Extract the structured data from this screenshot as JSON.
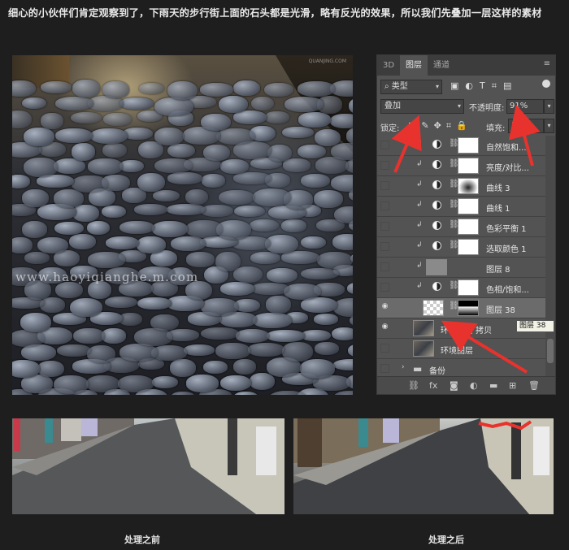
{
  "caption": "细心的小伙伴们肯定观察到了，下雨天的步行街上面的石头都是光滑，略有反光的效果，所以我们先叠加一层这样的素材",
  "photo": {
    "watermark_small": "QUANJING.COM",
    "watermark_big": "www.haoyiqianghe.m.com"
  },
  "panel": {
    "tabs": [
      {
        "label": "3D",
        "active": false
      },
      {
        "label": "图层",
        "active": true
      },
      {
        "label": "通道",
        "active": false
      }
    ],
    "filter": {
      "value": "类型",
      "icon": "search-icon"
    },
    "blend_mode": "叠加",
    "opacity_label": "不透明度:",
    "opacity_value": "91%",
    "lock_label": "锁定:",
    "fill_label": "填充:",
    "fill_value": "100",
    "layers": [
      {
        "name": "自然饱和...",
        "type": "adjustment",
        "selected": false,
        "visible": false
      },
      {
        "name": "亮度/对比...",
        "type": "adjustment",
        "selected": false,
        "visible": false
      },
      {
        "name": "曲线 3",
        "type": "adjustment-mask-dark",
        "selected": false,
        "visible": false
      },
      {
        "name": "曲线 1",
        "type": "adjustment",
        "selected": false,
        "visible": false
      },
      {
        "name": "色彩平衡 1",
        "type": "adjustment",
        "selected": false,
        "visible": false
      },
      {
        "name": "选取颜色 1",
        "type": "adjustment",
        "selected": false,
        "visible": false
      },
      {
        "name": "图层 8",
        "type": "pixel-gray",
        "selected": false,
        "visible": false
      },
      {
        "name": "色相/饱和...",
        "type": "adjustment",
        "selected": false,
        "visible": false
      },
      {
        "name": "图层 38",
        "type": "pixel-mask",
        "selected": true,
        "visible": true
      },
      {
        "name": "环境图层 拷贝",
        "type": "photo",
        "selected": false,
        "visible": true
      },
      {
        "name": "环境图层",
        "type": "photo",
        "selected": false,
        "visible": false
      },
      {
        "name": "备份",
        "type": "group",
        "selected": false,
        "visible": false
      }
    ],
    "tooltip": "图层 38"
  },
  "labels": {
    "before": "处理之前",
    "after": "处理之后"
  },
  "colors": {
    "arrow": "#e8322d",
    "panel_bg": "#535353",
    "page_bg": "#1e1e1e"
  }
}
